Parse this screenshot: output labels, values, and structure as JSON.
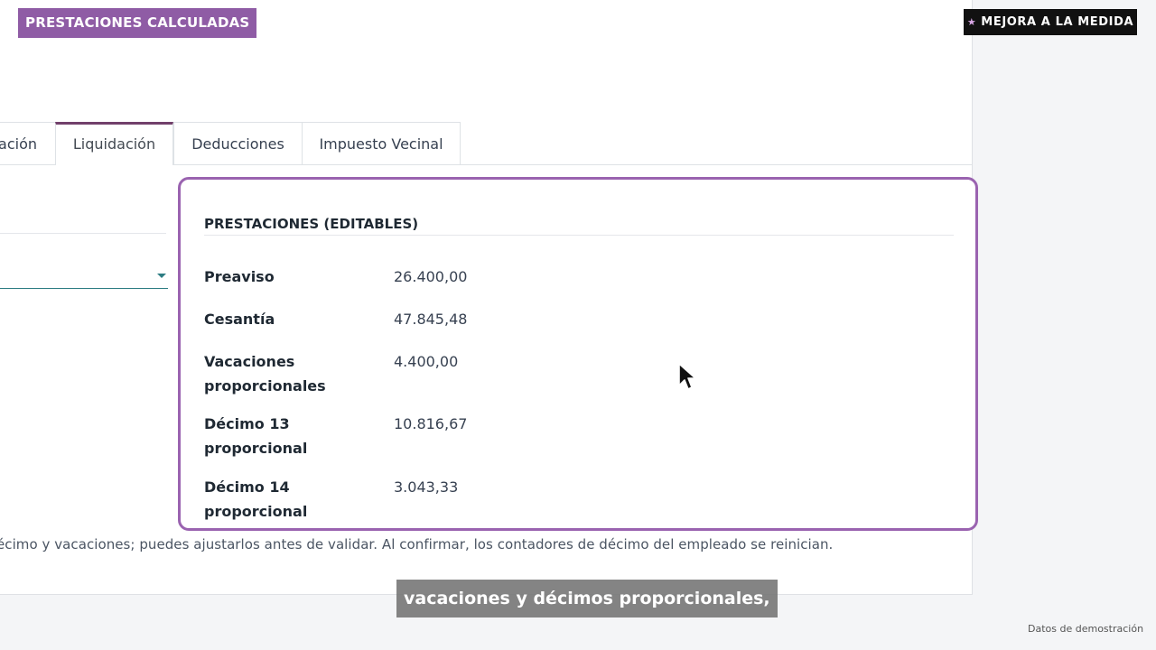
{
  "badges": {
    "top_left": "PRESTACIONES CALCULADAS",
    "top_right": "MEJORA A LA MEDIDA",
    "top_right_icon": "star-icon"
  },
  "tabs": [
    {
      "label": "ación",
      "active": false
    },
    {
      "label": "Liquidación",
      "active": true
    },
    {
      "label": "Deducciones",
      "active": false
    },
    {
      "label": "Impuesto Vecinal",
      "active": false
    }
  ],
  "card": {
    "title": "PRESTACIONES (EDITABLES)",
    "rows": [
      {
        "label": "Preaviso",
        "value": "26.400,00"
      },
      {
        "label": "Cesantía",
        "value": "47.845,48"
      },
      {
        "label": "Vacaciones proporcionales",
        "value": "4.400,00"
      },
      {
        "label": "Décimo 13 proporcional",
        "value": "10.816,67"
      },
      {
        "label": "Décimo 14 proporcional",
        "value": "3.043,33"
      }
    ]
  },
  "note": "écimo y vacaciones; puedes ajustarlos antes de validar. Al confirmar, los contadores de décimo del empleado se reinician.",
  "subtitle": "vacaciones y décimos proporcionales,",
  "footer": "Datos de demostración",
  "colors": {
    "accent_purple": "#8f5ca5",
    "tab_active_border": "#71406b",
    "select_underline": "#2d7d83"
  }
}
